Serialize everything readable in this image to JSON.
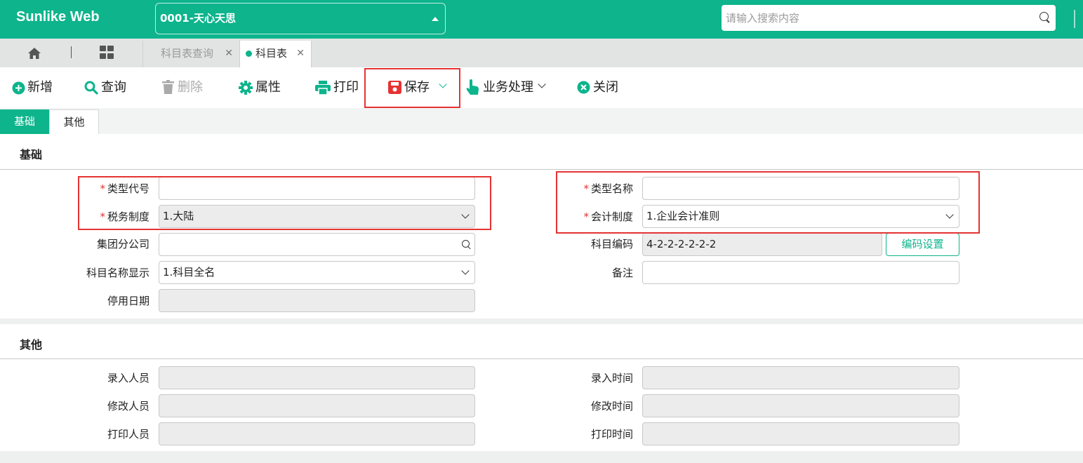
{
  "header": {
    "brand": "Sunlike Web",
    "company": "0001-天心天思",
    "search_placeholder": "请输入搜索内容"
  },
  "window_tabs": [
    {
      "label": "科目表查询",
      "active": false
    },
    {
      "label": "科目表",
      "active": true
    }
  ],
  "toolbar": {
    "add": "新增",
    "query": "查询",
    "delete": "删除",
    "properties": "属性",
    "print": "打印",
    "save": "保存",
    "business": "业务处理",
    "close": "关闭"
  },
  "form_tabs": [
    "基础",
    "其他"
  ],
  "section_basic": {
    "title": "基础",
    "type_code_label": "类型代号",
    "type_code_value": "",
    "tax_system_label": "税务制度",
    "tax_system_value": "1.大陆",
    "group_company_label": "集团分公司",
    "group_company_value": "",
    "name_display_label": "科目名称显示",
    "name_display_value": "1.科目全名",
    "disable_date_label": "停用日期",
    "disable_date_value": "",
    "type_name_label": "类型名称",
    "type_name_value": "",
    "accounting_system_label": "会计制度",
    "accounting_system_value": "1.企业会计准则",
    "subject_code_label": "科目编码",
    "subject_code_value": "4-2-2-2-2-2-2",
    "code_setting_button": "编码设置",
    "remark_label": "备注",
    "remark_value": ""
  },
  "section_other": {
    "title": "其他",
    "entry_person_label": "录入人员",
    "modify_person_label": "修改人员",
    "print_person_label": "打印人员",
    "entry_time_label": "录入时间",
    "modify_time_label": "修改时间",
    "print_time_label": "打印时间"
  },
  "colors": {
    "brand": "#0db48c",
    "required": "#e53333",
    "highlight": "#e53333"
  }
}
